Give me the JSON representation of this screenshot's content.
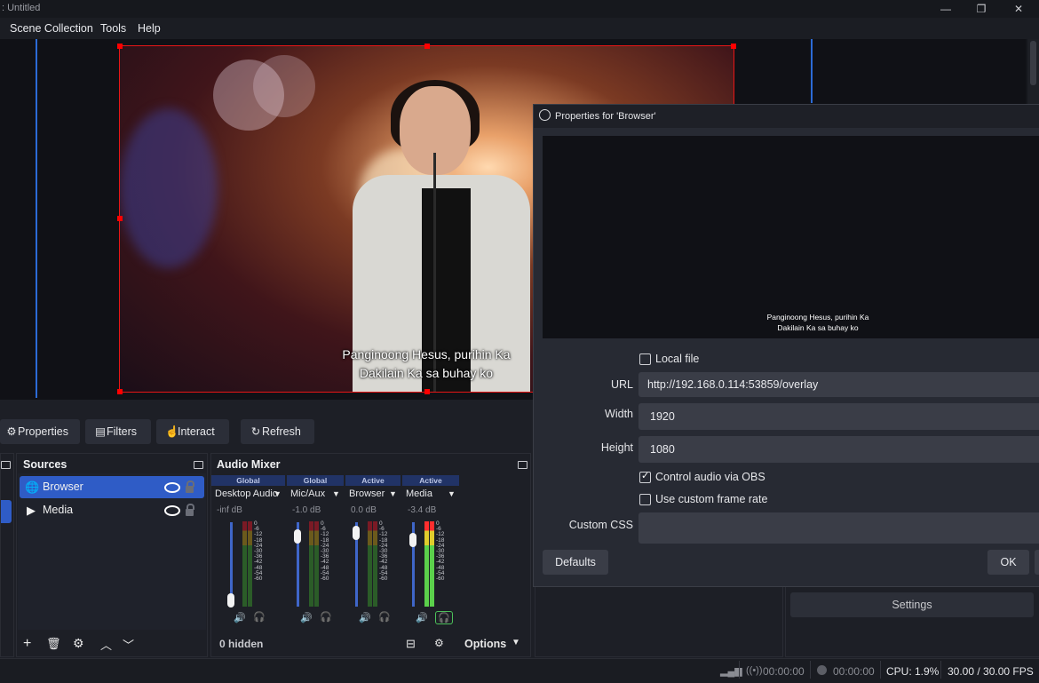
{
  "window": {
    "title": ": Untitled",
    "minimize": "—",
    "restore": "❐",
    "close": "✕"
  },
  "menu": [
    "Scene Collection",
    "Tools",
    "Help"
  ],
  "preview": {
    "subtitle_line1": "Panginoong Hesus, purihin Ka",
    "subtitle_line2": "Dakilain Ka sa buhay ko"
  },
  "toolbar": {
    "properties": "Properties",
    "filters": "Filters",
    "interact": "Interact",
    "refresh": "Refresh"
  },
  "sources": {
    "title": "Sources",
    "items": [
      {
        "label": "Browser",
        "selected": true
      },
      {
        "label": "Media",
        "selected": false
      }
    ]
  },
  "mixer": {
    "title": "Audio Mixer",
    "channels": [
      {
        "head": "Global",
        "name": "Desktop Audio",
        "db": "-inf dB",
        "level": 0.0
      },
      {
        "head": "Global",
        "name": "Mic/Aux",
        "db": "-1.0 dB",
        "level": 0.9
      },
      {
        "head": "Active",
        "name": "Browser",
        "db": "0.0 dB",
        "level": 0.95
      },
      {
        "head": "Active",
        "name": "Media",
        "db": "-3.4 dB",
        "level": 0.85
      }
    ],
    "scale": [
      "0",
      "-6",
      "-12",
      "-18",
      "-24",
      "-30",
      "-36",
      "-42",
      "-48",
      "-54",
      "-60"
    ],
    "hidden": "0 hidden",
    "options": "Options"
  },
  "properties_dialog": {
    "title": "Properties for 'Browser'",
    "preview_line1": "Panginoong Hesus, purihin Ka",
    "preview_line2": "Dakilain Ka sa buhay ko",
    "local_file": "Local file",
    "url_label": "URL",
    "url_value": "http://192.168.0.114:53859/overlay",
    "width_label": "Width",
    "width_value": "1920",
    "height_label": "Height",
    "height_value": "1080",
    "control_audio": "Control audio via OBS",
    "custom_frame_rate": "Use custom frame rate",
    "custom_css_label": "Custom CSS",
    "defaults": "Defaults",
    "ok": "OK"
  },
  "controls": {
    "settings": "Settings"
  },
  "status": {
    "stream_time": "00:00:00",
    "rec_time": "00:00:00",
    "cpu": "CPU: 1.9%",
    "fps": "30.00 / 30.00 FPS"
  }
}
